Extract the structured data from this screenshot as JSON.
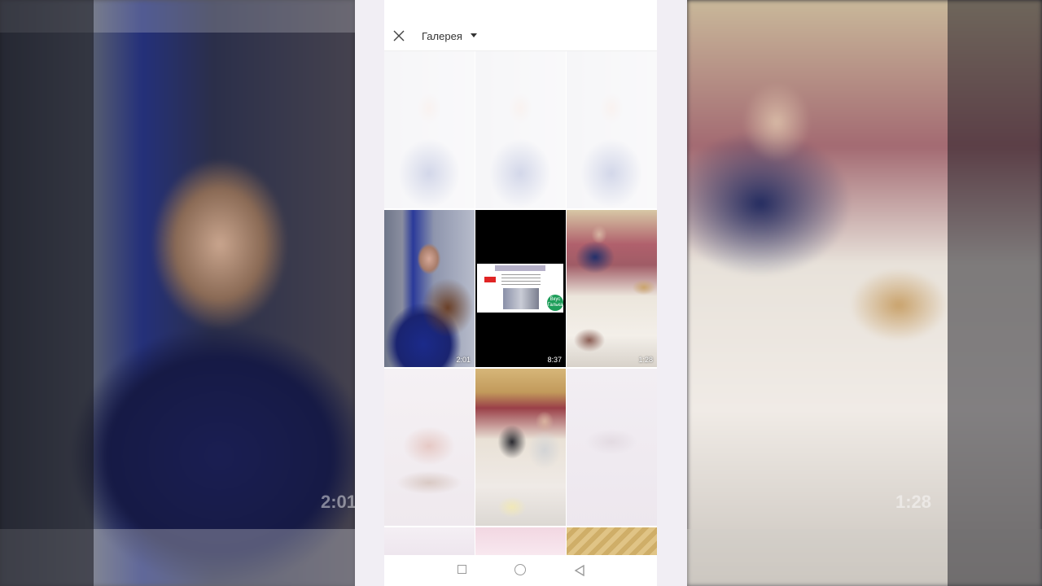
{
  "header": {
    "title": "Галерея"
  },
  "thumbnails": [
    {
      "id": "r1c1",
      "duration": ""
    },
    {
      "id": "r1c2",
      "duration": ""
    },
    {
      "id": "r1c3",
      "duration": ""
    },
    {
      "id": "r2c1",
      "duration": "2:01"
    },
    {
      "id": "r2c2",
      "duration": "8:37"
    },
    {
      "id": "r2c3",
      "duration": "1:28"
    },
    {
      "id": "r3c1",
      "duration": ""
    },
    {
      "id": "r3c2",
      "duration": ""
    },
    {
      "id": "r3c3",
      "duration": ""
    }
  ],
  "slide_logo_text": "Вкус Галька",
  "background": {
    "left_duration": "2:01",
    "right_duration": "1:28"
  },
  "icons": {
    "close": "close-icon",
    "dropdown": "chevron-down-icon",
    "recents": "square-icon",
    "home": "circle-icon",
    "back": "triangle-back-icon"
  }
}
